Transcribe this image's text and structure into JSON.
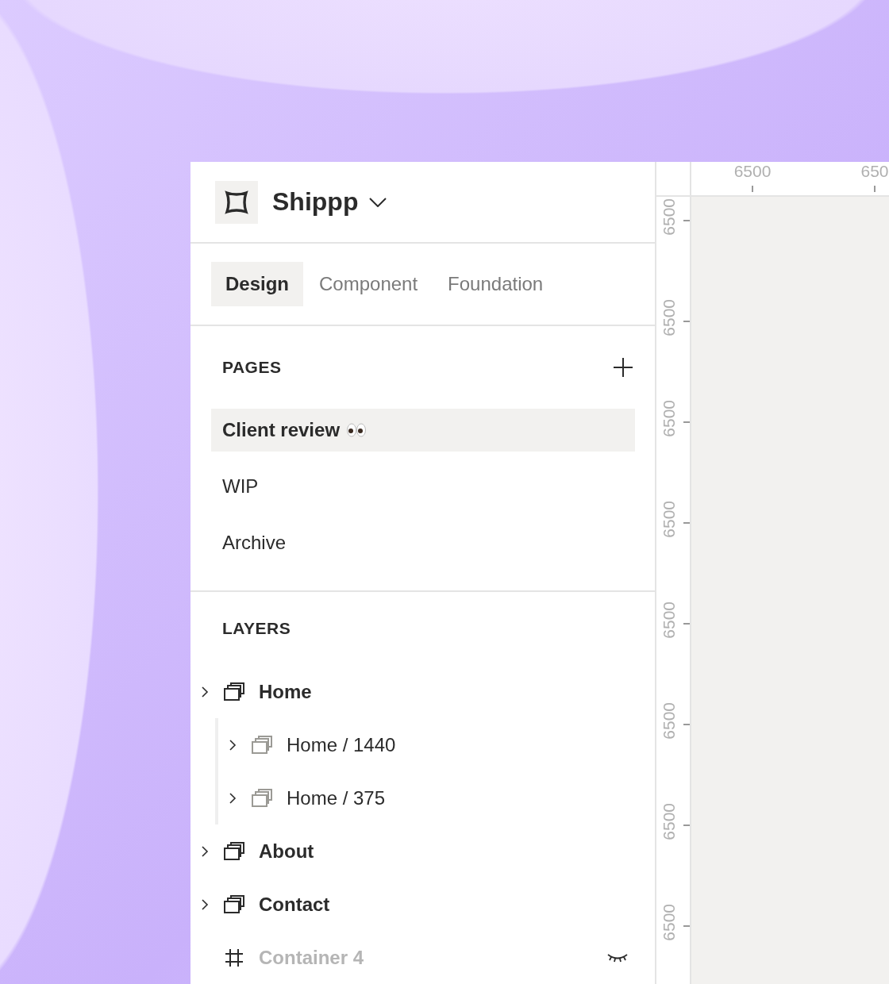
{
  "workspace": {
    "name": "Shippp"
  },
  "tabs": [
    {
      "label": "Design",
      "selected": true
    },
    {
      "label": "Component",
      "selected": false
    },
    {
      "label": "Foundation",
      "selected": false
    }
  ],
  "pages": {
    "title": "PAGES",
    "items": [
      {
        "label": "Client review",
        "selected": true
      },
      {
        "label": "WIP",
        "selected": false
      },
      {
        "label": "Archive",
        "selected": false
      }
    ]
  },
  "layers": {
    "title": "LAYERS",
    "items": [
      {
        "label": "Home",
        "kind": "page",
        "hidden": false,
        "children": [
          {
            "label": "Home / 1440",
            "kind": "page",
            "hidden": false
          },
          {
            "label": "Home / 375",
            "kind": "page",
            "hidden": false
          }
        ]
      },
      {
        "label": "About",
        "kind": "page",
        "hidden": false
      },
      {
        "label": "Contact",
        "kind": "page",
        "hidden": false
      },
      {
        "label": "Container 4",
        "kind": "frame",
        "hidden": true
      }
    ]
  },
  "canvas": {
    "top_ruler": [
      "6500",
      "650"
    ],
    "side_ruler": [
      "6500",
      "6500",
      "6500",
      "6500",
      "6500",
      "6500",
      "6500",
      "6500"
    ]
  }
}
